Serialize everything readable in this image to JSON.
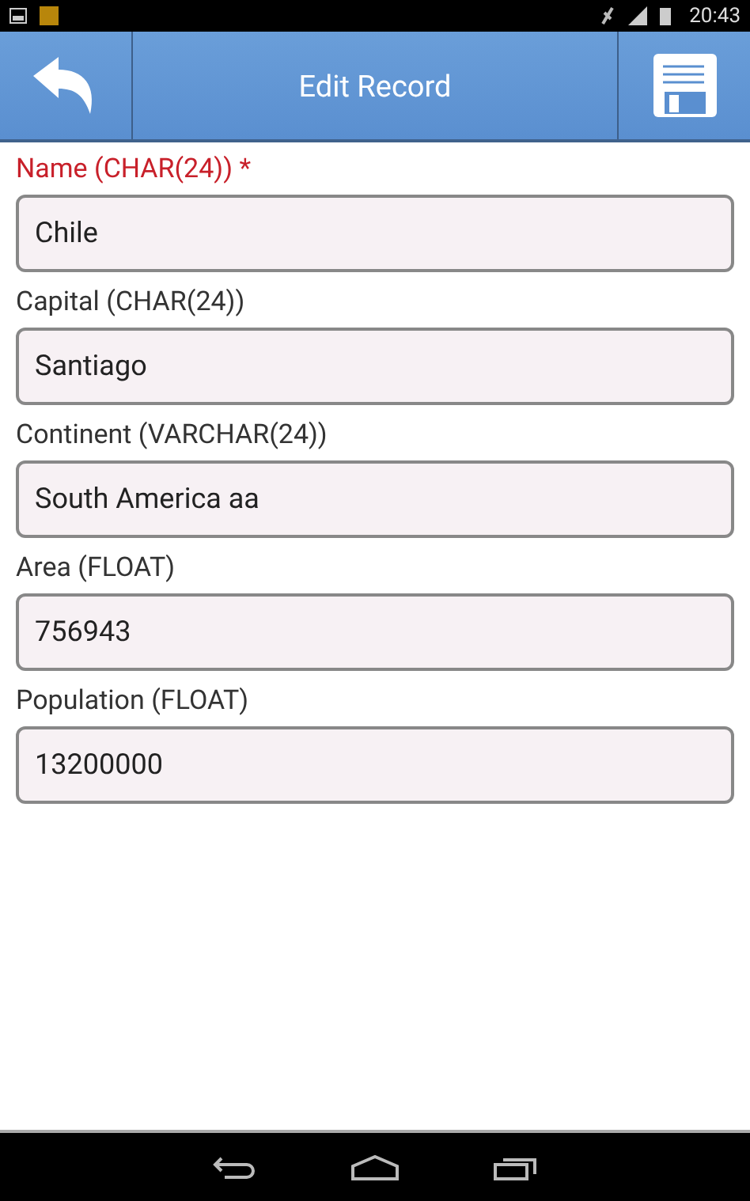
{
  "status_bar": {
    "time": "20:43"
  },
  "toolbar": {
    "title": "Edit Record"
  },
  "fields": [
    {
      "label": "Name (CHAR(24)) *",
      "value": "Chile",
      "required": true
    },
    {
      "label": "Capital (CHAR(24))",
      "value": "Santiago",
      "required": false
    },
    {
      "label": "Continent (VARCHAR(24))",
      "value": "South America aa",
      "required": false
    },
    {
      "label": "Area (FLOAT)",
      "value": "756943",
      "required": false
    },
    {
      "label": "Population (FLOAT)",
      "value": "13200000",
      "required": false
    }
  ]
}
